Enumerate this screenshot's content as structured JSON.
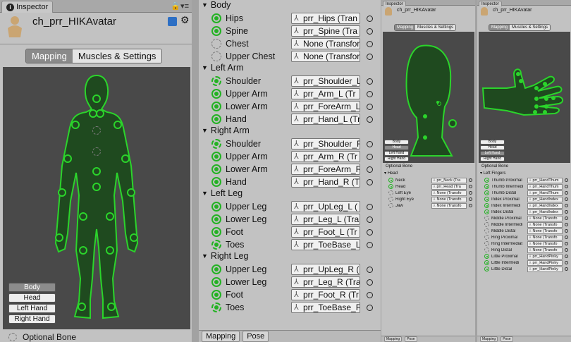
{
  "left_panel": {
    "tab_title": "Inspector",
    "object_name": "ch_prr_HIKAvatar",
    "tabs": [
      "Mapping",
      "Muscles & Settings"
    ],
    "part_buttons": [
      "Body",
      "Head",
      "Left Hand",
      "Right Hand"
    ],
    "optional_bone": "Optional Bone"
  },
  "middle_panel": {
    "groups": [
      {
        "title": "Body",
        "rows": [
          {
            "name": "Hips",
            "value": "prr_Hips (Tran",
            "state": "solid"
          },
          {
            "name": "Spine",
            "value": "prr_Spine (Tra",
            "state": "solid"
          },
          {
            "name": "Chest",
            "value": "None (Transfor",
            "state": "empty"
          },
          {
            "name": "Upper Chest",
            "value": "None (Transfor",
            "state": "empty"
          }
        ]
      },
      {
        "title": "Left Arm",
        "rows": [
          {
            "name": "Shoulder",
            "value": "prr_Shoulder_L",
            "state": "dash"
          },
          {
            "name": "Upper Arm",
            "value": "prr_Arm_L (Tr",
            "state": "solid"
          },
          {
            "name": "Lower Arm",
            "value": "prr_ForeArm_L",
            "state": "solid"
          },
          {
            "name": "Hand",
            "value": "prr_Hand_L (Tr",
            "state": "solid"
          }
        ]
      },
      {
        "title": "Right Arm",
        "rows": [
          {
            "name": "Shoulder",
            "value": "prr_Shoulder_R",
            "state": "dash"
          },
          {
            "name": "Upper Arm",
            "value": "prr_Arm_R (Tr",
            "state": "solid"
          },
          {
            "name": "Lower Arm",
            "value": "prr_ForeArm_R",
            "state": "solid"
          },
          {
            "name": "Hand",
            "value": "prr_Hand_R (Tr",
            "state": "solid"
          }
        ]
      },
      {
        "title": "Left Leg",
        "rows": [
          {
            "name": "Upper Leg",
            "value": "prr_UpLeg_L (",
            "state": "solid"
          },
          {
            "name": "Lower Leg",
            "value": "prr_Leg_L (Tra",
            "state": "solid"
          },
          {
            "name": "Foot",
            "value": "prr_Foot_L (Tr",
            "state": "solid"
          },
          {
            "name": "Toes",
            "value": "prr_ToeBase_L",
            "state": "dash"
          }
        ]
      },
      {
        "title": "Right Leg",
        "rows": [
          {
            "name": "Upper Leg",
            "value": "prr_UpLeg_R (",
            "state": "solid"
          },
          {
            "name": "Lower Leg",
            "value": "prr_Leg_R (Tra",
            "state": "solid"
          },
          {
            "name": "Foot",
            "value": "prr_Foot_R (Tr",
            "state": "solid"
          },
          {
            "name": "Toes",
            "value": "prr_ToeBase_R",
            "state": "dash"
          }
        ]
      }
    ],
    "bottom": [
      "Mapping",
      "Pose"
    ]
  },
  "head_panel": {
    "tab_title": "Inspector",
    "object_name": "ch_prr_HIKAvatar",
    "tabs": [
      "Mapping",
      "Muscles & Settings"
    ],
    "part_buttons": [
      "Body",
      "Head",
      "Left Hand",
      "Right Hand"
    ],
    "optional_bone": "Optional Bone",
    "group": "Head",
    "rows": [
      {
        "name": "Neck",
        "value": "prr_Neck (Tra",
        "state": "solid"
      },
      {
        "name": "Head",
        "value": "prr_Head (Tra",
        "state": "solid"
      },
      {
        "name": "Left Eye",
        "value": "None (Transfo",
        "state": "empty"
      },
      {
        "name": "Right Eye",
        "value": "None (Transfo",
        "state": "empty"
      },
      {
        "name": "Jaw",
        "value": "None (Transfo",
        "state": "empty"
      }
    ],
    "bottom": [
      "Mapping",
      "Pose"
    ]
  },
  "hand_panel": {
    "tab_title": "Inspector",
    "object_name": "ch_prr_HIKAvatar",
    "tabs": [
      "Mapping",
      "Muscles & Settings"
    ],
    "part_buttons": [
      "Body",
      "Head",
      "Left Hand",
      "Right Hand"
    ],
    "optional_bone": "Optional Bone",
    "group": "Left Fingers",
    "rows": [
      {
        "name": "Thumb Proximal",
        "value": "prr_HandThum",
        "state": "solid"
      },
      {
        "name": "Thumb Intermedi",
        "value": "prr_HandThum",
        "state": "solid"
      },
      {
        "name": "Thumb Distal",
        "value": "prr_HandThum",
        "state": "solid"
      },
      {
        "name": "Index Proximal",
        "value": "prr_HandIndex",
        "state": "solid"
      },
      {
        "name": "Index Intermedi",
        "value": "prr_HandIndex",
        "state": "solid"
      },
      {
        "name": "Index Distal",
        "value": "prr_HandIndex",
        "state": "solid"
      },
      {
        "name": "Middle Proximal",
        "value": "None (Transfo",
        "state": "empty"
      },
      {
        "name": "Middle Intermedi",
        "value": "None (Transfo",
        "state": "empty"
      },
      {
        "name": "Middle Distal",
        "value": "None (Transfo",
        "state": "empty"
      },
      {
        "name": "Ring Proximal",
        "value": "None (Transfo",
        "state": "empty"
      },
      {
        "name": "Ring Intermediat",
        "value": "None (Transfo",
        "state": "empty"
      },
      {
        "name": "Ring Distal",
        "value": "None (Transfo",
        "state": "empty"
      },
      {
        "name": "Little Proximal",
        "value": "prr_HandPinky",
        "state": "solid"
      },
      {
        "name": "Little Intermedi",
        "value": "prr_HandPinky",
        "state": "solid"
      },
      {
        "name": "Little Distal",
        "value": "prr_HandPinky",
        "state": "solid"
      }
    ],
    "bottom": [
      "Mapping",
      "Pose"
    ]
  }
}
